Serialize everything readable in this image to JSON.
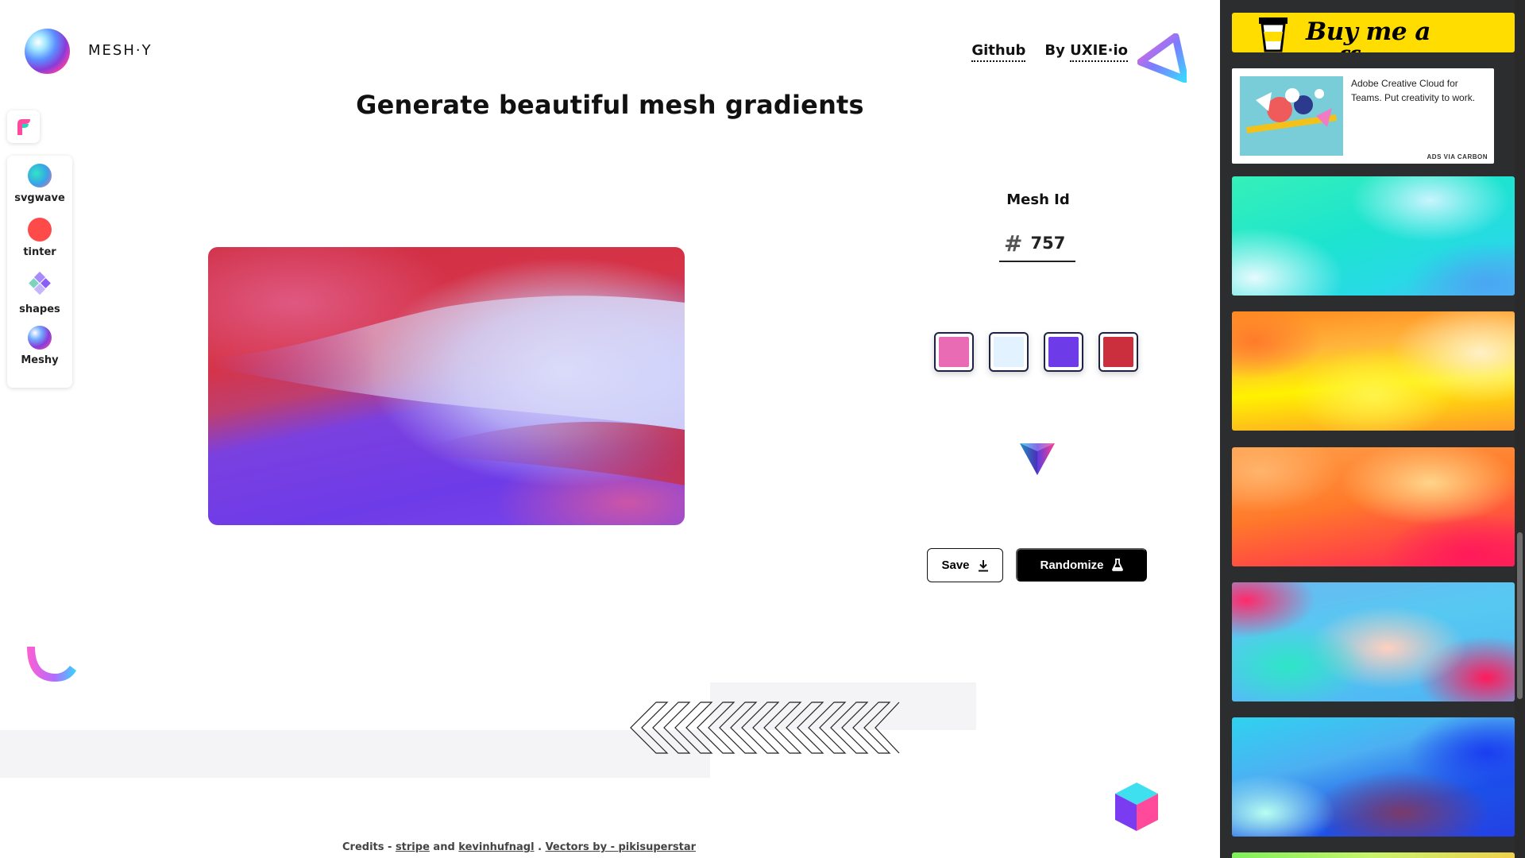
{
  "header": {
    "brand": "MESH·Y",
    "title": "Generate beautiful mesh gradients",
    "links": {
      "github": "Github",
      "by_prefix": "By",
      "by_name": "UXIE·io"
    }
  },
  "dock": {
    "items": [
      {
        "label": "svgwave",
        "icon": "svgwave-icon"
      },
      {
        "label": "tinter",
        "icon": "tinter-icon"
      },
      {
        "label": "shapes",
        "icon": "shapes-icon"
      },
      {
        "label": "Meshy",
        "icon": "meshy-icon"
      }
    ]
  },
  "controls": {
    "mesh_label": "Mesh Id",
    "mesh_hash": "#",
    "mesh_id": "757",
    "colors": [
      "#e96bb3",
      "#e2f3ff",
      "#6e3be8",
      "#cb2f3d"
    ],
    "save_label": "Save",
    "randomize_label": "Randomize"
  },
  "credits": {
    "prefix": "Credits -",
    "stripe": "stripe",
    "and": "and",
    "kevin": "kevinhufnagl",
    "sep": ".",
    "vectors": "Vectors by - pikisuperstar"
  },
  "sidebar": {
    "coffee_text": "Buy me a coffee",
    "ad_text": "Adobe Creative Cloud for Teams. Put creativity to work.",
    "ad_via": "ADS VIA CARBON"
  }
}
